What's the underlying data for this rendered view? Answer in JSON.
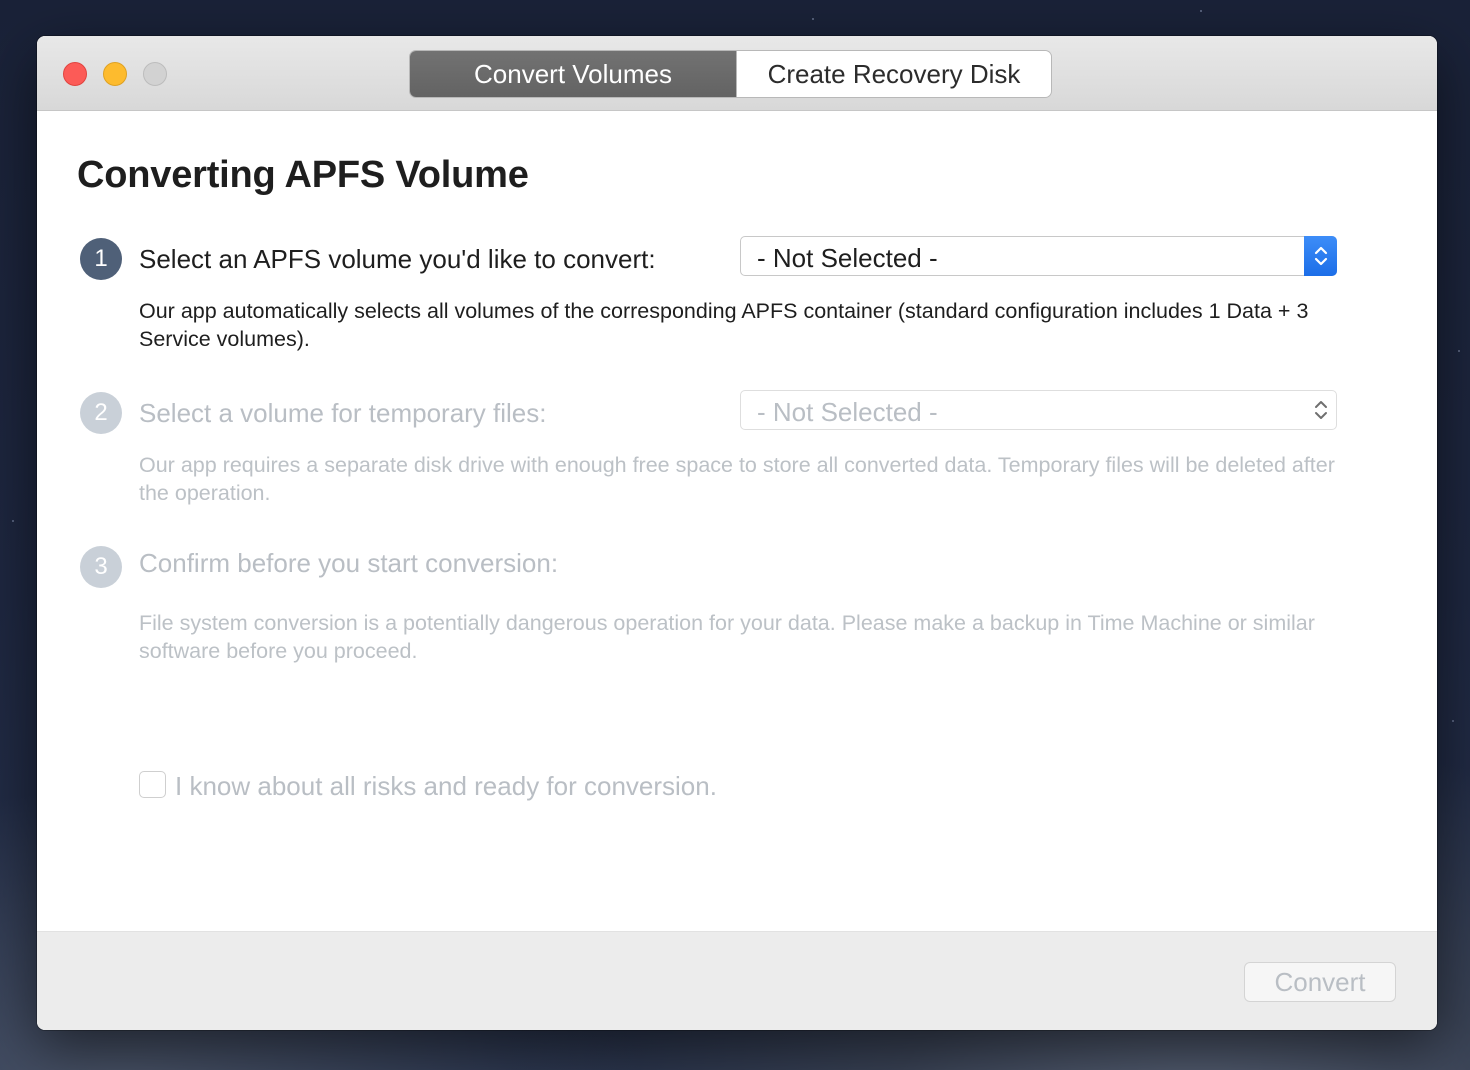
{
  "window": {
    "tabs": [
      {
        "label": "Convert Volumes",
        "selected": true
      },
      {
        "label": "Create Recovery Disk",
        "selected": false
      }
    ]
  },
  "main": {
    "title": "Converting APFS Volume",
    "steps": [
      {
        "number": "1",
        "label": "Select an APFS volume you'd like to convert:",
        "select_value": "- Not Selected -",
        "description": "Our app automatically selects all volumes of the corresponding APFS container (standard configuration includes 1 Data + 3 Service volumes).",
        "enabled": true
      },
      {
        "number": "2",
        "label": "Select a volume for temporary files:",
        "select_value": "- Not Selected -",
        "description": "Our app requires a separate disk drive with enough free space to store all converted data. Temporary files will be deleted after the operation.",
        "enabled": false
      },
      {
        "number": "3",
        "label": "Confirm before you start conversion:",
        "description": "File system conversion is a potentially dangerous operation for your data. Please make a backup in Time Machine or similar software before you proceed.",
        "enabled": false
      }
    ],
    "confirm_checkbox": {
      "label": "I know about all risks and ready for conversion.",
      "checked": false
    }
  },
  "footer": {
    "convert_label": "Convert",
    "convert_enabled": false
  },
  "colors": {
    "accent_blue": "#1c6ee8",
    "active_tab": "#6a6a6a",
    "step_badge_active": "#4f6078",
    "step_badge_disabled": "#c9d0d8",
    "close": "#fc5b57",
    "minimize": "#fdbb2e",
    "zoom_inactive": "#d2d2d2"
  }
}
